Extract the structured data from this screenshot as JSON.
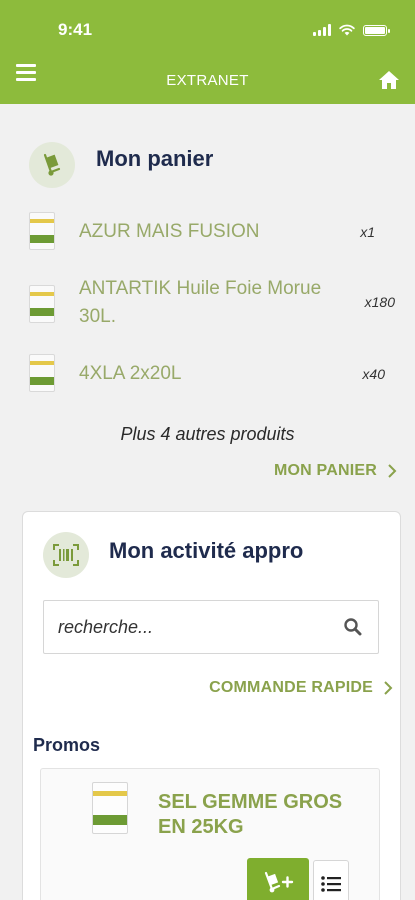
{
  "status_bar": {
    "time": "9:41"
  },
  "header": {
    "title": "EXTRANET"
  },
  "cart": {
    "title": "Mon panier",
    "items": [
      {
        "name": "AZUR MAIS FUSION",
        "qty": "x1"
      },
      {
        "name": "ANTARTIK Huile Foie Morue 30L.",
        "qty": "x180"
      },
      {
        "name": "4XLA 2x20L",
        "qty": "x40"
      }
    ],
    "more_text": "Plus 4 autres produits",
    "link_label": "MON PANIER"
  },
  "activity": {
    "title": "Mon activité appro",
    "search_placeholder": "recherche...",
    "quick_order_label": "COMMANDE RAPIDE"
  },
  "promos": {
    "title": "Promos",
    "items": [
      {
        "name": "SEL GEMME GROS EN 25KG"
      }
    ]
  },
  "colors": {
    "brand_green": "#8dbb3c",
    "navy": "#1f2b4d",
    "olive_text": "#8aa24c"
  }
}
